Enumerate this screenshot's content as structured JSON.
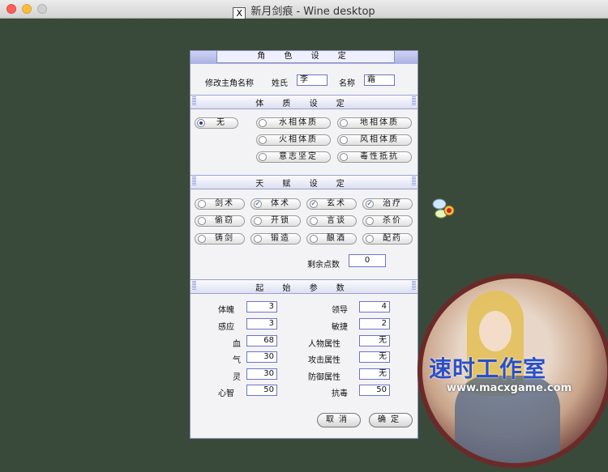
{
  "window": {
    "title": "新月剑痕 - Wine desktop",
    "app_icon_glyph": "X"
  },
  "dialog": {
    "title": "角 色 设 定",
    "name_row": {
      "label": "修改主角名称",
      "surname_label": "姓氏",
      "surname_value": "李",
      "given_label": "名称",
      "given_value": "霜"
    },
    "physique": {
      "title": "体 质 设 定",
      "options": [
        {
          "label": "无",
          "selected": true
        },
        {
          "label": "水相体质",
          "selected": false
        },
        {
          "label": "地相体质",
          "selected": false
        },
        {
          "label": "火相体质",
          "selected": false
        },
        {
          "label": "风相体质",
          "selected": false
        },
        {
          "label": "意志坚定",
          "selected": false
        },
        {
          "label": "毒性抵抗",
          "selected": false
        }
      ]
    },
    "talent": {
      "title": "天 赋 设 定",
      "items": [
        {
          "label": "剑术",
          "checked": false
        },
        {
          "label": "体术",
          "checked": true
        },
        {
          "label": "玄术",
          "checked": true
        },
        {
          "label": "治疗",
          "checked": true
        },
        {
          "label": "偷窃",
          "checked": false
        },
        {
          "label": "开锁",
          "checked": false
        },
        {
          "label": "言谈",
          "checked": false
        },
        {
          "label": "杀价",
          "checked": false
        },
        {
          "label": "铸剑",
          "checked": false
        },
        {
          "label": "锻造",
          "checked": false
        },
        {
          "label": "酿酒",
          "checked": false
        },
        {
          "label": "配药",
          "checked": false
        }
      ],
      "remaining_label": "剩余点数",
      "remaining_value": "0"
    },
    "stats": {
      "title": "起 始 参 数",
      "left": [
        {
          "label": "体魄",
          "value": "3"
        },
        {
          "label": "感应",
          "value": "3"
        },
        {
          "label": "血",
          "value": "68"
        },
        {
          "label": "气",
          "value": "30"
        },
        {
          "label": "灵",
          "value": "30"
        },
        {
          "label": "心智",
          "value": "50"
        }
      ],
      "right": [
        {
          "label": "领导",
          "value": "4"
        },
        {
          "label": "敏捷",
          "value": "2"
        },
        {
          "label": "人物属性",
          "value": "无"
        },
        {
          "label": "攻击属性",
          "value": "无"
        },
        {
          "label": "防御属性",
          "value": "无"
        },
        {
          "label": "抗毒",
          "value": "50"
        }
      ]
    },
    "buttons": {
      "cancel": "取消",
      "ok": "确定"
    }
  },
  "watermark": {
    "title": "速时工作室",
    "url": "www.macxgame.com"
  },
  "colors": {
    "desktop": "#3a4a3a",
    "accent": "#6c74c8",
    "header_band": "#aab0e4"
  }
}
